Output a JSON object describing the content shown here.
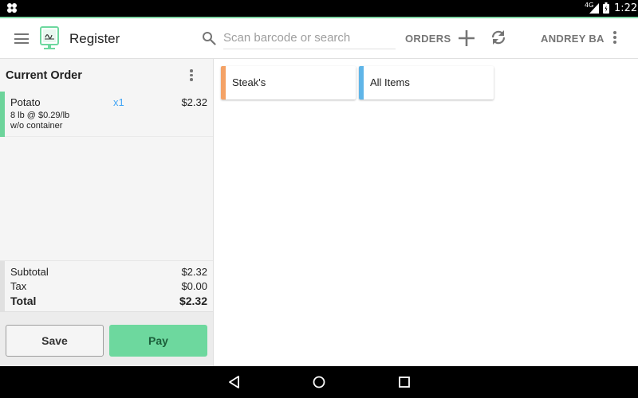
{
  "status_bar": {
    "network": "4G",
    "time": "1:22"
  },
  "header": {
    "title": "Register",
    "search_placeholder": "Scan barcode or search",
    "orders_label": "ORDERS",
    "user_label": "ANDREY BA",
    "icons": [
      "menu-icon",
      "register-logo-icon",
      "search-icon",
      "plus-icon",
      "sync-icon",
      "more-vert-icon"
    ]
  },
  "order": {
    "title": "Current Order",
    "items": [
      {
        "name": "Potato",
        "qty": "x1",
        "price": "$2.32",
        "detail1": "8 lb @ $0.29/lb",
        "detail2": "w/o container"
      }
    ],
    "subtotal_label": "Subtotal",
    "subtotal": "$2.32",
    "tax_label": "Tax",
    "tax": "$0.00",
    "total_label": "Total",
    "total": "$2.32",
    "save_label": "Save",
    "pay_label": "Pay"
  },
  "categories": [
    {
      "label": "Steak's",
      "color": "#f4a266"
    },
    {
      "label": "All Items",
      "color": "#5fb5e8"
    }
  ],
  "colors": {
    "accent_green": "#6dd89e",
    "qty_blue": "#42a5f5"
  }
}
